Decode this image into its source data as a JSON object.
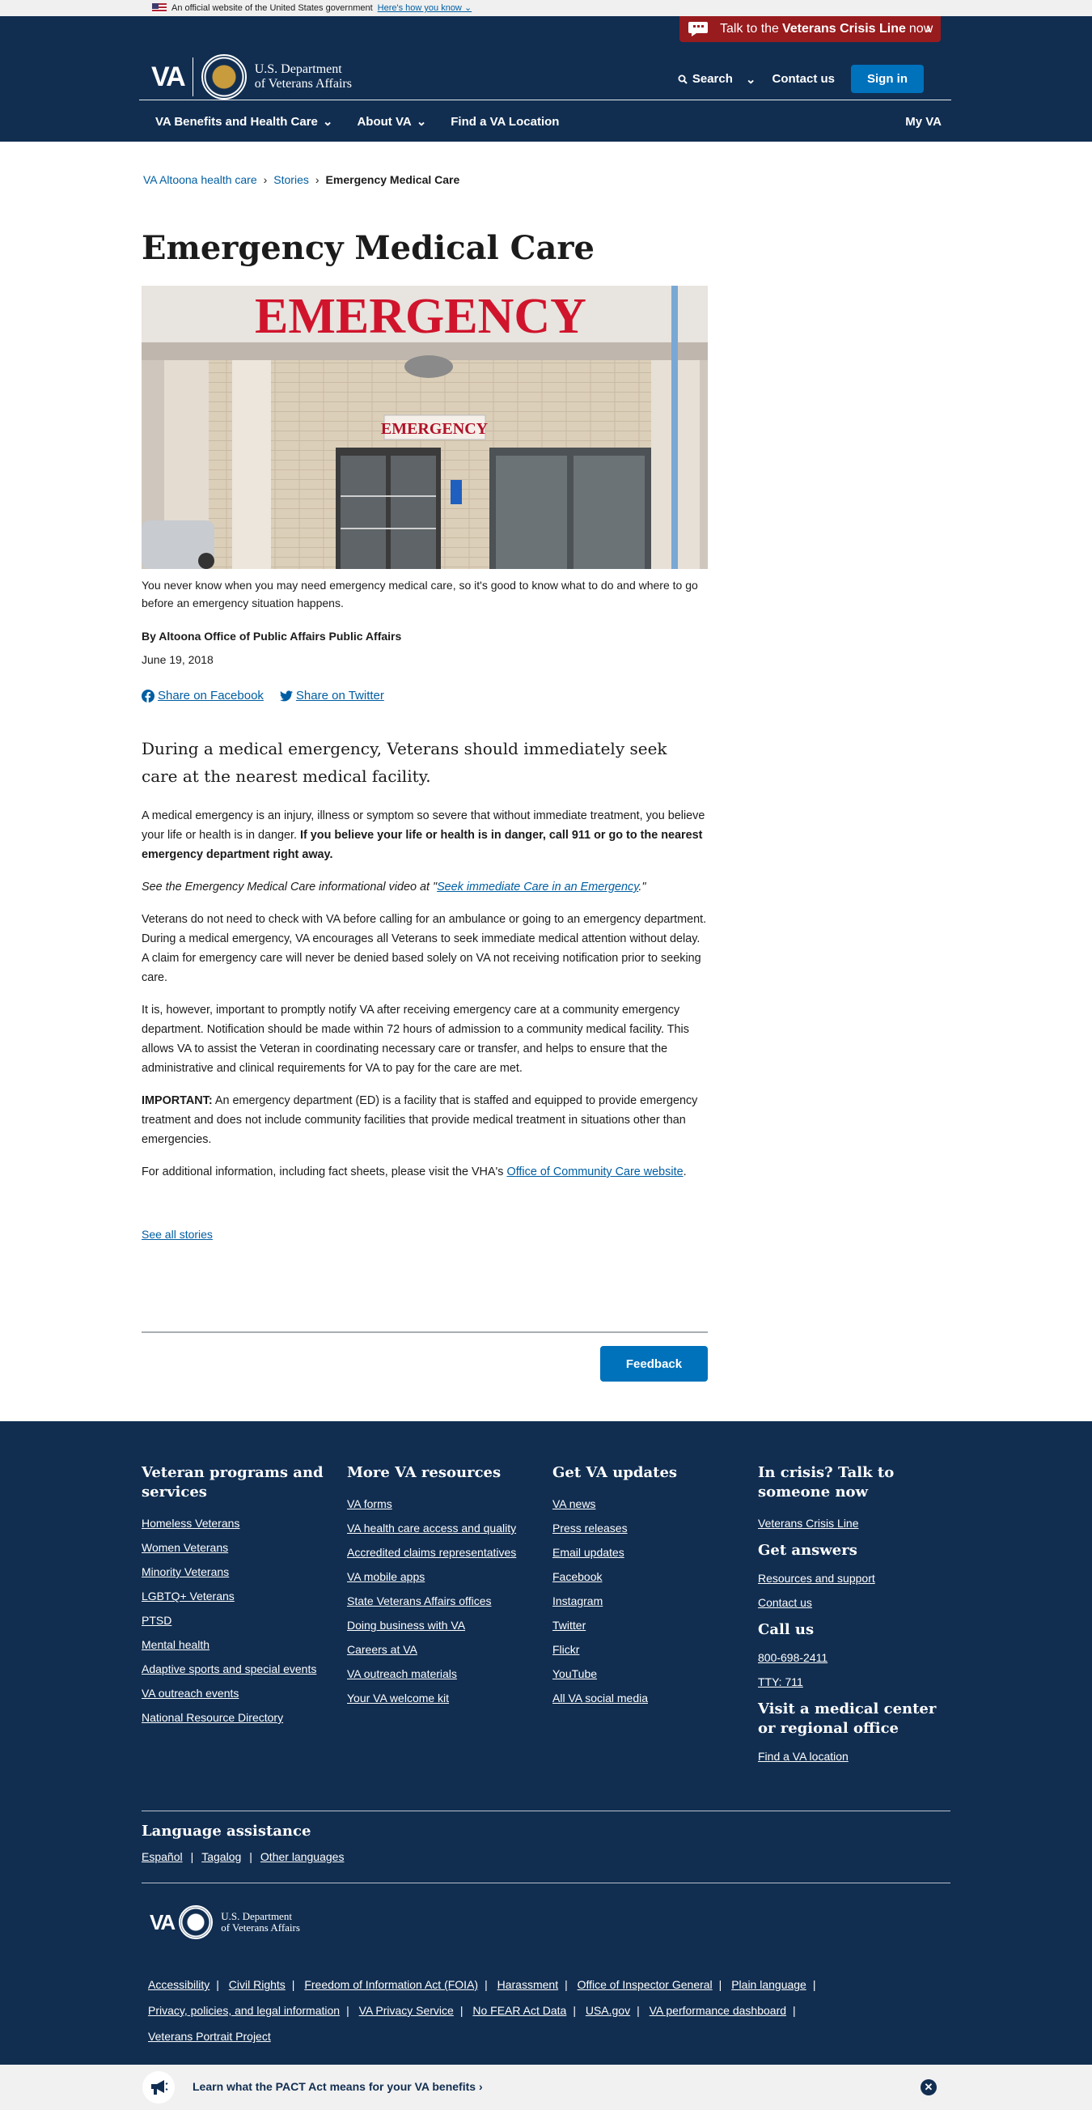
{
  "gov_banner": {
    "text": "An official website of the United States government",
    "link": "Here's how you know"
  },
  "crisis": {
    "prefix": "Talk to the",
    "bold": "Veterans Crisis Line",
    "suffix": "now"
  },
  "header": {
    "logo_va": "VA",
    "logo_line1": "U.S. Department",
    "logo_line2": "of Veterans Affairs",
    "search": "Search",
    "contact": "Contact us",
    "signin": "Sign in"
  },
  "nav": {
    "benefits": "VA Benefits and Health Care",
    "about": "About VA",
    "find": "Find a VA Location",
    "myva": "My VA"
  },
  "breadcrumb": {
    "item1": "VA Altoona health care",
    "item2": "Stories",
    "current": "Emergency Medical Care"
  },
  "article": {
    "title": "Emergency Medical Care",
    "hero_sign_top": "EMERGENCY",
    "hero_sign_door": "EMERGENCY",
    "caption": "You never know when you may need emergency medical care, so it's good to know what to do and where to go before an emergency situation happens.",
    "byline": "By Altoona Office of Public Affairs Public Affairs",
    "date": "June 19, 2018",
    "share_facebook": "Share on Facebook",
    "share_twitter": "Share on Twitter",
    "lead": "During a medical emergency, Veterans should immediately seek care at the nearest medical facility.",
    "p1_text": "A medical emergency is an injury, illness or symptom so severe that without immediate treatment, you believe your life or health is in danger. ",
    "p1_bold": "If you believe your life or health is in danger, call 911 or go to the nearest emergency department right away.",
    "p2_pre": "See the Emergency Medical Care informational video at \"",
    "p2_link": "Seek immediate Care in an Emergency",
    "p2_post": ".\"",
    "p3": "Veterans do not need to check with VA before calling for an ambulance or going to an emergency department. During a medical emergency, VA encourages all Veterans to seek immediate medical attention without delay. A claim for emergency care will never be denied based solely on VA not receiving notification prior to seeking care.",
    "p4": "It is, however, important to promptly notify VA after receiving emergency care at a community emergency department. Notification should be made within 72 hours of admission to a community medical facility. This allows VA to assist the Veteran in coordinating necessary care or transfer, and helps to ensure that the administrative and clinical requirements for VA to pay for the care are met.",
    "p5_bold": "IMPORTANT:",
    "p5_text": " An emergency department (ED) is a facility that is staffed and equipped to provide emergency treatment and does not include community facilities that provide medical treatment in situations other than emergencies.",
    "p6_pre": "For additional information, including fact sheets, please visit the VHA's ",
    "p6_link": "Office of Community Care website",
    "p6_post": ".",
    "see_all": "See all stories",
    "feedback": "Feedback"
  },
  "footer": {
    "col1_title": "Veteran programs and services",
    "col1_links": [
      "Homeless Veterans",
      "Women Veterans",
      "Minority Veterans",
      "LGBTQ+ Veterans",
      "PTSD",
      "Mental health",
      "Adaptive sports and special events",
      "VA outreach events",
      "National Resource Directory"
    ],
    "col2_title": "More VA resources",
    "col2_links": [
      "VA forms",
      "VA health care access and quality",
      "Accredited claims representatives",
      "VA mobile apps",
      "State Veterans Affairs offices",
      "Doing business with VA",
      "Careers at VA",
      "VA outreach materials",
      "Your VA welcome kit"
    ],
    "col3_title": "Get VA updates",
    "col3_links": [
      "VA news",
      "Press releases",
      "Email updates",
      "Facebook",
      "Instagram",
      "Twitter",
      "Flickr",
      "YouTube",
      "All VA social media"
    ],
    "col4_title": "In crisis? Talk to someone now",
    "col4_crisis_link": "Veterans Crisis Line",
    "col4_answers_title": "Get answers",
    "col4_resources": "Resources and support",
    "col4_contact": "Contact us",
    "col4_call_title": "Call us",
    "col4_phone": "800-698-2411",
    "col4_tty": "TTY: 711",
    "col4_visit_title": "Visit a medical center or regional office",
    "col4_find": "Find a VA location",
    "lang_title": "Language assistance",
    "lang_links": [
      "Español",
      "Tagalog",
      "Other languages"
    ],
    "bottom_links": [
      "Accessibility",
      "Civil Rights",
      "Freedom of Information Act (FOIA)",
      "Harassment",
      "Office of Inspector General",
      "Plain language",
      "Privacy, policies, and legal information",
      "VA Privacy Service",
      "No FEAR Act Data",
      "USA.gov",
      "VA performance dashboard",
      "Veterans Portrait Project"
    ]
  },
  "pact": {
    "text": "Learn what the PACT Act means for your VA benefits"
  }
}
